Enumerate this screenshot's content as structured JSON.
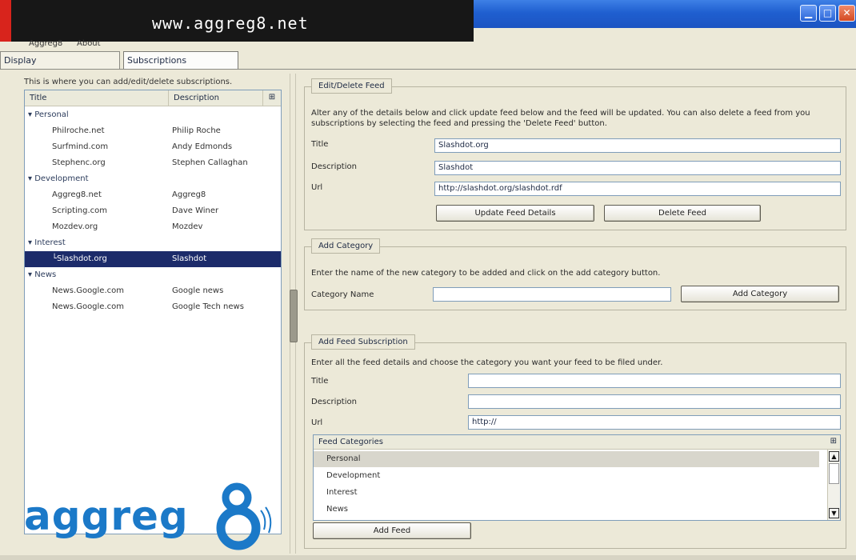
{
  "window": {
    "url_banner": "www.aggreg8.net",
    "min_glyph": "▁",
    "max_glyph": "□",
    "close_glyph": "✕"
  },
  "menu": {
    "items": [
      "Aggreg8",
      "About"
    ]
  },
  "tabs": [
    {
      "label": "Display",
      "active": false
    },
    {
      "label": "Subscriptions",
      "active": true
    }
  ],
  "left": {
    "hint": "This is where you can add/edit/delete subscriptions.",
    "columns": {
      "title": "Title",
      "description": "Description"
    },
    "tree": [
      {
        "kind": "category",
        "title": "▾ Personal",
        "description": ""
      },
      {
        "kind": "feed",
        "title": "Philroche.net",
        "description": "Philip Roche"
      },
      {
        "kind": "feed",
        "title": "Surfmind.com",
        "description": "Andy Edmonds"
      },
      {
        "kind": "feed",
        "title": "Stephenc.org",
        "description": "Stephen Callaghan"
      },
      {
        "kind": "category",
        "title": "▾ Development",
        "description": ""
      },
      {
        "kind": "feed",
        "title": "Aggreg8.net",
        "description": "Aggreg8"
      },
      {
        "kind": "feed",
        "title": "Scripting.com",
        "description": "Dave Winer"
      },
      {
        "kind": "feed",
        "title": "Mozdev.org",
        "description": "Mozdev"
      },
      {
        "kind": "category",
        "title": "▾ Interest",
        "description": ""
      },
      {
        "kind": "feed",
        "title": "└Slashdot.org",
        "description": "Slashdot",
        "selected": true
      },
      {
        "kind": "category",
        "title": "▾ News",
        "description": ""
      },
      {
        "kind": "feed",
        "title": "News.Google.com",
        "description": "Google news"
      },
      {
        "kind": "feed",
        "title": "News.Google.com",
        "description": "Google Tech news"
      }
    ],
    "logo_text": "aggreg"
  },
  "edit": {
    "legend": "Edit/Delete Feed",
    "desc": "Alter any of the details below and click update feed below and the feed will be updated. You can also delete a feed from you subscriptions by selecting the feed and pressing the 'Delete Feed' button.",
    "title_label": "Title",
    "title_value": "Slashdot.org",
    "description_label": "Description",
    "description_value": "Slashdot",
    "url_label": "Url",
    "url_value": "http://slashdot.org/slashdot.rdf",
    "update_button": "Update Feed Details",
    "delete_button": "Delete Feed"
  },
  "category": {
    "legend": "Add Category",
    "desc": "Enter the name of the new category to be added and click on the add category button.",
    "name_label": "Category Name",
    "name_value": "",
    "add_button": "Add Category"
  },
  "add": {
    "legend": "Add Feed Subscription",
    "desc": "Enter all the feed details and choose the category you want your feed to be filed under.",
    "title_label": "Title",
    "title_value": "",
    "description_label": "Description",
    "description_value": "",
    "url_label": "Url",
    "url_value": "http://",
    "list_header": "Feed Categories",
    "categories": [
      "Personal",
      "Development",
      "Interest",
      "News"
    ],
    "add_button": "Add Feed"
  }
}
